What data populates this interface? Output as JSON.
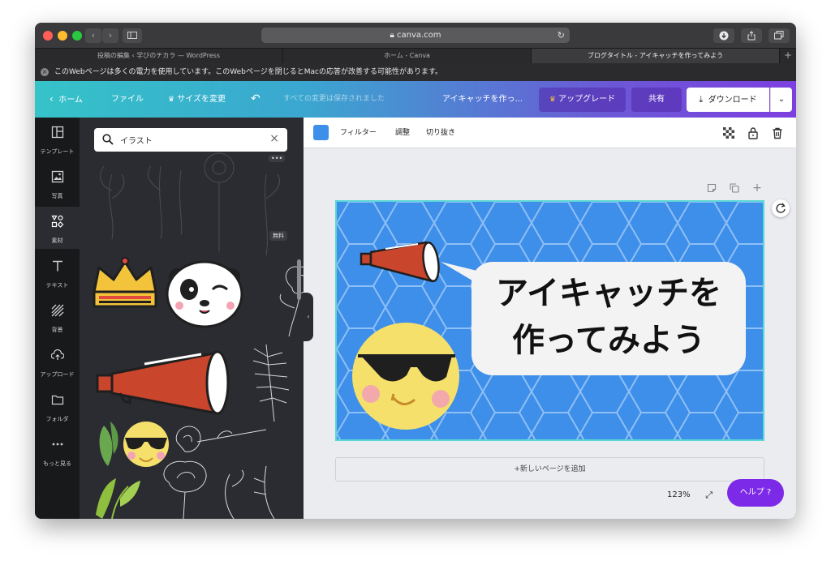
{
  "browser": {
    "url": "canva.com",
    "tabs": [
      {
        "label": "投稿の編集 ‹ 学びのチカラ — WordPress",
        "active": false
      },
      {
        "label": "ホーム - Canva",
        "active": false
      },
      {
        "label": "ブログタイトル - アイキャッチを作ってみよう",
        "active": true
      }
    ],
    "warning": "このWebページは多くの電力を使用しています。このWebページを閉じるとMacの応答が改善する可能性があります。"
  },
  "header": {
    "home": "ホーム",
    "file": "ファイル",
    "resize": "サイズを変更",
    "saved": "すべての変更は保存されました",
    "doc_title": "アイキャッチを作っ...",
    "upgrade": "アップグレード",
    "share": "共有",
    "download": "ダウンロード"
  },
  "leftnav": [
    {
      "label": "テンプレート",
      "icon": "template-icon"
    },
    {
      "label": "写真",
      "icon": "photo-icon"
    },
    {
      "label": "素材",
      "icon": "elements-icon",
      "active": true
    },
    {
      "label": "テキスト",
      "icon": "text-icon"
    },
    {
      "label": "背景",
      "icon": "background-icon"
    },
    {
      "label": "アップロード",
      "icon": "upload-icon"
    },
    {
      "label": "フォルダ",
      "icon": "folder-icon"
    },
    {
      "label": "もっと見る",
      "icon": "more-icon"
    }
  ],
  "panel": {
    "search_value": "イラスト",
    "more_label": "•••",
    "free_badge": "無料"
  },
  "toolbar": {
    "filter": "フィルター",
    "adjust": "調整",
    "crop": "切り抜き",
    "swatch_color": "#3d8fea"
  },
  "design": {
    "line1": "アイキャッチを",
    "line2": "作ってみよう",
    "bg_color": "#3d8fea"
  },
  "editor": {
    "add_page": "+新しいページを追加",
    "zoom": "123%",
    "help": "ヘルプ ?"
  }
}
